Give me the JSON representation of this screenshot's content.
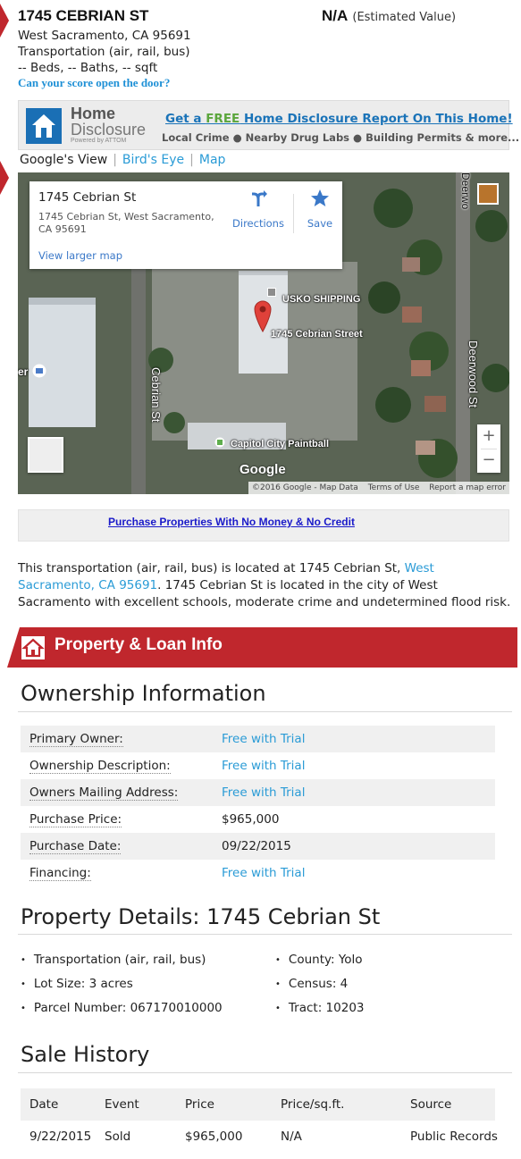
{
  "header": {
    "address_title": "1745 CEBRIAN ST",
    "estimated_value": "N/A",
    "estimated_value_label": "(Estimated Value)",
    "city_line": "West Sacramento, CA 95691",
    "property_type": "Transportation (air, rail, bus)",
    "specs": "-- Beds, -- Baths, -- sqft",
    "score_link": "Can your score open the door?"
  },
  "home_disclosure": {
    "logo_line1": "Home",
    "logo_line2": "Disclosure",
    "logo_line3": "Powered by ATTOM",
    "headline_pre": "Get a ",
    "headline_free": "FREE",
    "headline_post": " Home Disclosure Report On This Home!",
    "subline": "Local Crime ● Nearby Drug Labs ● Building Permits  & more..."
  },
  "map_tabs": {
    "google_view": "Google's View",
    "birds_eye": "Bird's Eye",
    "map": "Map",
    "separator": "|"
  },
  "map": {
    "card_title": "1745 Cebrian St",
    "card_address": "1745 Cebrian St, West Sacramento, CA 95691",
    "directions_label": "Directions",
    "save_label": "Save",
    "larger_map": "View larger map",
    "labels": {
      "usko": "USKO SHIPPING",
      "pin_label": "1745 Cebrian Street",
      "paintball": "Capitol City Paintball",
      "cebrian_st": "Cebrian St",
      "deerwood_st": "Deerwood St",
      "deerwood_top": "Deerwo",
      "left_cut": "er"
    },
    "zoom_in": "+",
    "zoom_out": "−",
    "google_logo": "Google",
    "attribution": "©2016 Google - Map Data",
    "terms": "Terms of Use",
    "report": "Report a map error"
  },
  "ad": {
    "link": "Purchase Properties With No Money & No Credit"
  },
  "description": {
    "pre": "This transportation (air, rail, bus) is located at 1745 Cebrian St, ",
    "link": "West Sacramento, CA 95691",
    "post": ". 1745 Cebrian St is located in the city of West Sacramento with excellent schools, moderate crime and undetermined flood risk."
  },
  "section_banner": {
    "title": "Property & Loan Info"
  },
  "ownership": {
    "heading": "Ownership Information",
    "rows": [
      {
        "key": "Primary Owner:",
        "value": "Free with Trial"
      },
      {
        "key": "Ownership Description:",
        "value": "Free with Trial"
      },
      {
        "key": "Owners Mailing Address:",
        "value": "Free with Trial"
      },
      {
        "key": "Purchase Price:",
        "value": "$965,000"
      },
      {
        "key": "Purchase Date:",
        "value": "09/22/2015"
      },
      {
        "key": "Financing:",
        "value": "Free with Trial"
      }
    ]
  },
  "property_details": {
    "heading": "Property Details: 1745 Cebrian St",
    "left": [
      "Transportation (air, rail, bus)",
      "Lot Size: 3 acres",
      "Parcel Number: 067170010000"
    ],
    "right": [
      "County: Yolo",
      "Census: 4",
      "Tract: 10203"
    ]
  },
  "sale_history": {
    "heading": "Sale History",
    "columns": [
      "Date",
      "Event",
      "Price",
      "Price/sq.ft.",
      "Source"
    ],
    "rows": [
      [
        "9/22/2015",
        "Sold",
        "$965,000",
        "N/A",
        "Public Records"
      ]
    ]
  },
  "colors": {
    "accent_red": "#c0272d",
    "link_blue": "#2a9bd6",
    "free_green": "#5ba63c"
  }
}
